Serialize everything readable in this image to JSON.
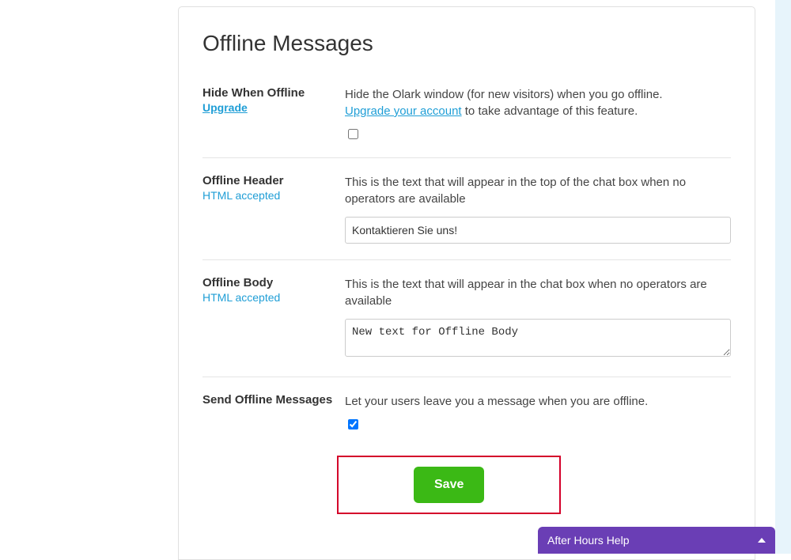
{
  "title": "Offline Messages",
  "hide": {
    "label": "Hide When Offline",
    "upgrade": "Upgrade",
    "desc_pre": "Hide the Olark window (for new visitors) when you go offline.",
    "upgrade_link": "Upgrade your account",
    "desc_post": " to take advantage of this feature."
  },
  "header": {
    "label": "Offline Header",
    "note": "HTML accepted",
    "desc": "This is the text that will appear in the top of the chat box when no operators are available",
    "value": "Kontaktieren Sie uns!"
  },
  "bodySection": {
    "label": "Offline Body",
    "note": "HTML accepted",
    "desc": "This is the text that will appear in the chat box when no operators are available",
    "value": "New text for Offline Body"
  },
  "send": {
    "label": "Send Offline Messages",
    "desc": "Let your users leave you a message when you are offline."
  },
  "save": "Save",
  "chat": "After Hours Help"
}
